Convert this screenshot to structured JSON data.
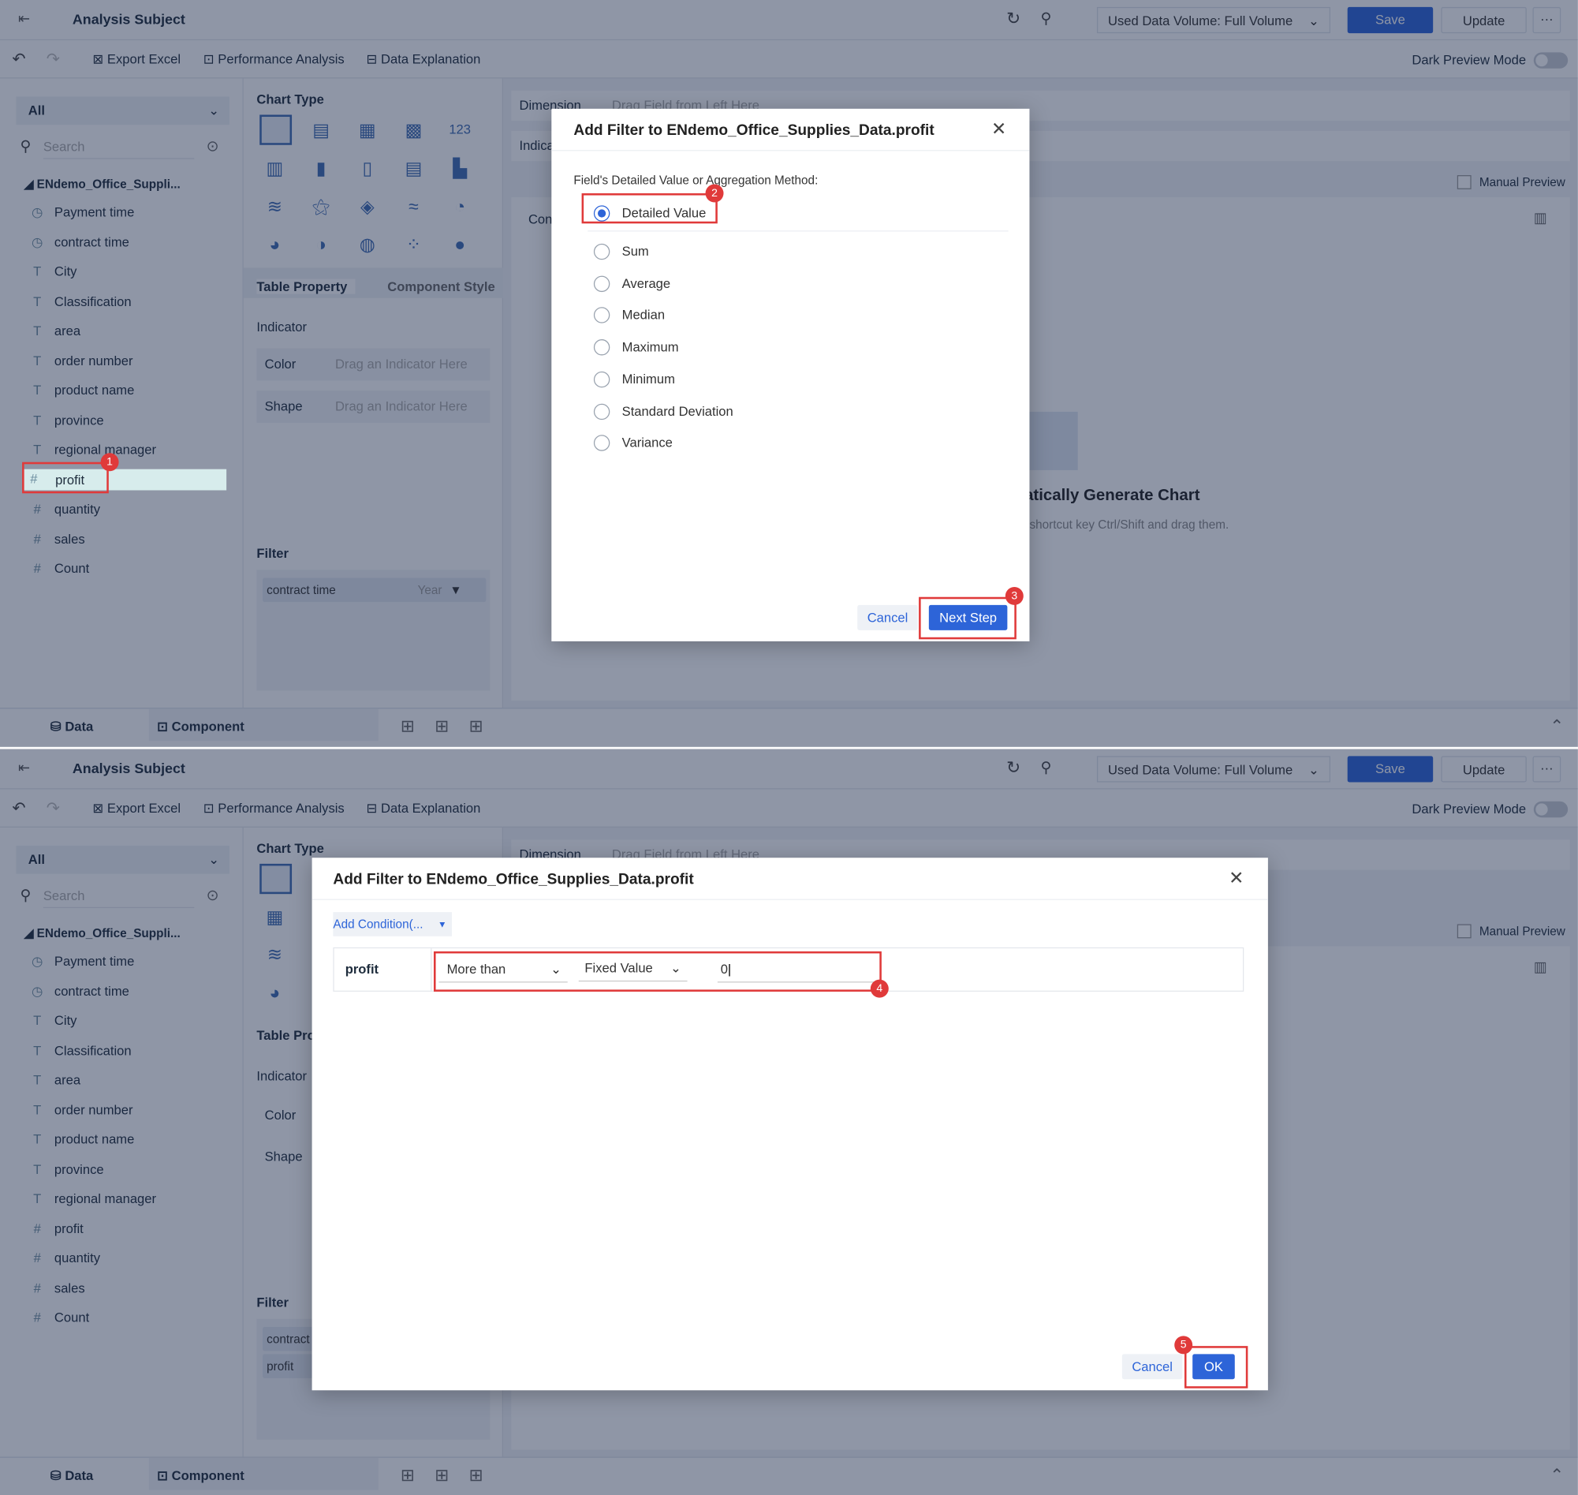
{
  "top_bar": {
    "title": "Analysis Subject",
    "data_volume": "Used Data Volume: Full Volume",
    "save": "Save",
    "update": "Update",
    "more": "···"
  },
  "toolbar": {
    "export_excel": "Export Excel",
    "performance_analysis": "Performance Analysis",
    "data_explanation": "Data Explanation",
    "dark_preview": "Dark Preview Mode"
  },
  "left_panel": {
    "filter_select": "All",
    "search_placeholder": "Search",
    "dataset": "ENdemo_Office_Suppli...",
    "fields": [
      {
        "icon": "clock-icon",
        "name": "Payment time"
      },
      {
        "icon": "clock-icon",
        "name": "contract time"
      },
      {
        "icon": "text-icon",
        "name": "City"
      },
      {
        "icon": "text-icon",
        "name": "Classification"
      },
      {
        "icon": "text-icon",
        "name": "area"
      },
      {
        "icon": "text-icon",
        "name": "order number"
      },
      {
        "icon": "text-icon",
        "name": "product name"
      },
      {
        "icon": "text-icon",
        "name": "province"
      },
      {
        "icon": "text-icon",
        "name": "regional manager"
      },
      {
        "icon": "hash-icon",
        "name": "profit"
      },
      {
        "icon": "hash-icon",
        "name": "quantity"
      },
      {
        "icon": "hash-icon",
        "name": "sales"
      },
      {
        "icon": "hash-icon",
        "name": "Count"
      }
    ]
  },
  "middle_panel": {
    "chart_type": "Chart Type",
    "table_property": "Table Property",
    "component_style": "Component Style",
    "indicator": "Indicator",
    "color": "Color",
    "shape": "Shape",
    "drag_indicator": "Drag an Indicator Here",
    "filter": "Filter",
    "filter_chip": "contract time",
    "filter_chip_year": "Year",
    "filter_chip2": "profit",
    "table_pro_short": "Table Pro",
    "contract_short": "contract"
  },
  "right_panel": {
    "dimension": "Dimension",
    "drag_field": "Drag Field from Left Here",
    "indicator_short": "Indica",
    "manual_preview": "Manual Preview",
    "con_short": "Con",
    "auto_generate": "atically Generate Chart",
    "hint": "shortcut key Ctrl/Shift and drag them."
  },
  "bottom_bar": {
    "data": "Data",
    "component": "Component"
  },
  "dialog1": {
    "title_prefix": "Add Filter to",
    "title_field": "ENdemo_Office_Supplies_Data.profit",
    "question": "Field's Detailed Value or Aggregation Method:",
    "options": [
      "Detailed Value",
      "Sum",
      "Average",
      "Median",
      "Maximum",
      "Minimum",
      "Standard Deviation",
      "Variance"
    ],
    "selected": "Detailed Value",
    "cancel": "Cancel",
    "next": "Next Step"
  },
  "dialog2": {
    "title_prefix": "Add Filter to",
    "title_field": "ENdemo_Office_Supplies_Data.profit",
    "add_condition": "Add Condition(...",
    "condition": {
      "field": "profit",
      "operator": "More than",
      "value_type": "Fixed Value",
      "value": "0"
    },
    "cancel": "Cancel",
    "ok": "OK"
  },
  "step_badges": [
    "1",
    "2",
    "3",
    "4",
    "5"
  ],
  "colors": {
    "accent": "#2d64d8",
    "highlight_red": "#e03a3a",
    "selected_field": "#d7ecec"
  }
}
